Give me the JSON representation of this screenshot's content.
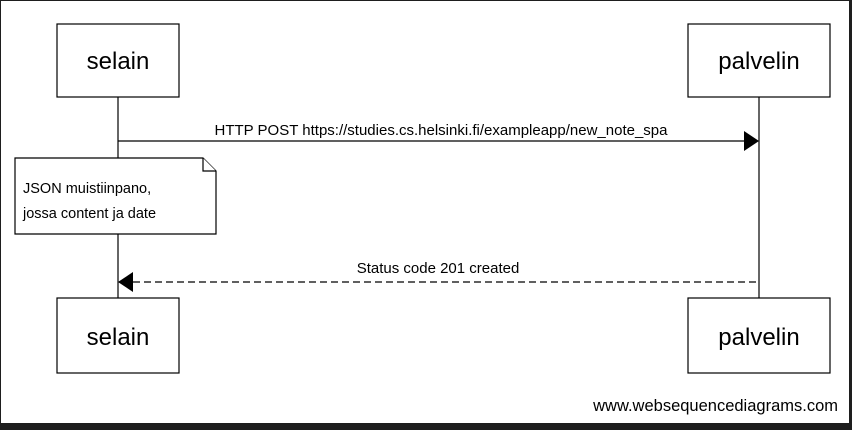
{
  "participants": {
    "client": "selain",
    "server": "palvelin"
  },
  "messages": [
    {
      "label": "HTTP POST https://studies.cs.helsinki.fi/exampleapp/new_note_spa",
      "style": "solid"
    },
    {
      "label": "Status code 201 created",
      "style": "dashed"
    }
  ],
  "note": {
    "lines": [
      "JSON muistiinpano,",
      "jossa content ja date"
    ]
  },
  "watermark": "www.websequencediagrams.com",
  "colors": {
    "background": "#ffffff",
    "border": "#1e1e1e",
    "ink": "#000000"
  }
}
